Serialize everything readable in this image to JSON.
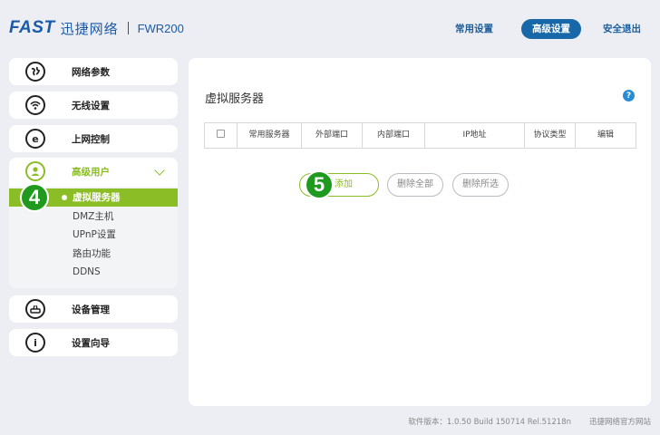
{
  "header": {
    "logo_brand": "FAST",
    "logo_cn": "迅捷网络",
    "model": "FWR200",
    "nav": {
      "common": "常用设置",
      "advanced": "高级设置",
      "logout": "安全退出"
    }
  },
  "sidebar": {
    "items": {
      "network": {
        "label": "网络参数",
        "icon": "globe-icon"
      },
      "wireless": {
        "label": "无线设置",
        "icon": "wifi-icon"
      },
      "access": {
        "label": "上网控制",
        "icon": "ie-icon"
      },
      "device": {
        "label": "设备管理",
        "icon": "router-icon"
      },
      "wizard": {
        "label": "设置向导",
        "icon": "info-icon"
      }
    },
    "advanced_group": {
      "label": "高级用户",
      "icon": "user-icon",
      "sub_items": [
        "虚拟服务器",
        "DMZ主机",
        "UPnP设置",
        "路由功能",
        "DDNS"
      ],
      "active_index": 0
    }
  },
  "badges": {
    "step4": "4",
    "step5": "5"
  },
  "main": {
    "title": "虚拟服务器",
    "help": "?",
    "table_headers": [
      "常用服务器",
      "外部端口",
      "内部端口",
      "IP地址",
      "协议类型",
      "编辑"
    ],
    "buttons": {
      "add": "添加",
      "delete_all": "删除全部",
      "delete_selected": "删除所选"
    }
  },
  "footer": {
    "version": "软件版本：1.0.50 Build 150714 Rel.51218n",
    "link": "迅捷网络官方网站"
  },
  "colors": {
    "accent": "#8bbd27",
    "brand": "#1a5aa6",
    "badge": "#1f9a1f"
  }
}
